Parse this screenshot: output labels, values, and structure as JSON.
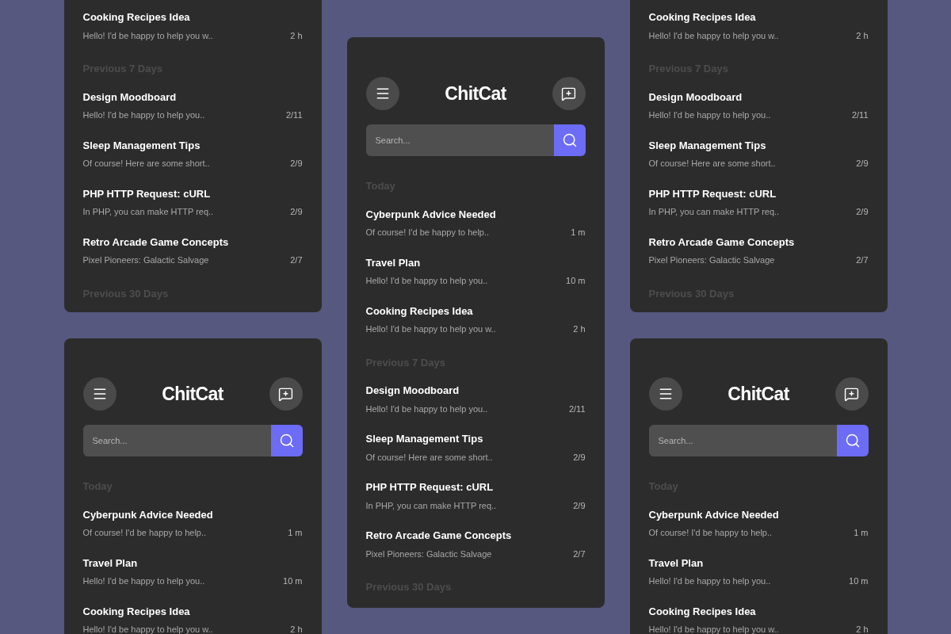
{
  "columns": [
    {
      "screens": [
        {
          "sections": [
            {
              "items": [
                {
                  "title": "Cooking Recipes Idea",
                  "preview": "Hello! I'd be happy to help you w..",
                  "time": "2 h"
                }
              ]
            },
            {
              "title": "Previous 7 Days",
              "items": [
                {
                  "title": "Design Moodboard",
                  "preview": "Hello! I'd be happy to help you..",
                  "time": "2/11"
                },
                {
                  "title": "Sleep Management Tips",
                  "preview": "Of course! Here are some short..",
                  "time": "2/9"
                },
                {
                  "title": "PHP HTTP Request: cURL",
                  "preview": "In PHP, you can make HTTP req..",
                  "time": "2/9"
                },
                {
                  "title": "Retro Arcade Game Concepts",
                  "preview": "Pixel Pioneers: Galactic Salvage",
                  "time": "2/7"
                }
              ]
            },
            {
              "title": "Previous 30 Days"
            }
          ]
        },
        {
          "header": {
            "logo": "ChitCat",
            "search_placeholder": "Search..."
          },
          "sections": [
            {
              "title": "Today",
              "items": [
                {
                  "title": "Cyberpunk Advice Needed",
                  "preview": "Of course! I'd be happy to help..",
                  "time": "1 m"
                },
                {
                  "title": "Travel Plan",
                  "preview": "Hello! I'd be happy to help you..",
                  "time": "10 m"
                },
                {
                  "title": "Cooking Recipes Idea",
                  "preview": "Hello! I'd be happy to help you w..",
                  "time": "2 h"
                }
              ]
            }
          ]
        }
      ]
    },
    {
      "screens": [
        {
          "header": {
            "logo": "ChitCat",
            "search_placeholder": "Search..."
          },
          "sections": [
            {
              "title": "Today",
              "items": [
                {
                  "title": "Cyberpunk Advice Needed",
                  "preview": "Of course! I'd be happy to help..",
                  "time": "1 m"
                },
                {
                  "title": "Travel Plan",
                  "preview": "Hello! I'd be happy to help you..",
                  "time": "10 m"
                },
                {
                  "title": "Cooking Recipes Idea",
                  "preview": "Hello! I'd be happy to help you w..",
                  "time": "2 h"
                }
              ]
            },
            {
              "title": "Previous 7 Days",
              "items": [
                {
                  "title": "Design Moodboard",
                  "preview": "Hello! I'd be happy to help you..",
                  "time": "2/11"
                },
                {
                  "title": "Sleep Management Tips",
                  "preview": "Of course! Here are some short..",
                  "time": "2/9"
                },
                {
                  "title": "PHP HTTP Request: cURL",
                  "preview": "In PHP, you can make HTTP req..",
                  "time": "2/9"
                },
                {
                  "title": "Retro Arcade Game Concepts",
                  "preview": "Pixel Pioneers: Galactic Salvage",
                  "time": "2/7"
                }
              ]
            },
            {
              "title": "Previous 30 Days"
            }
          ]
        }
      ]
    },
    {
      "screens": [
        {
          "sections": [
            {
              "items": [
                {
                  "title": "Cooking Recipes Idea",
                  "preview": "Hello! I'd be happy to help you w..",
                  "time": "2 h"
                }
              ]
            },
            {
              "title": "Previous 7 Days",
              "items": [
                {
                  "title": "Design Moodboard",
                  "preview": "Hello! I'd be happy to help you..",
                  "time": "2/11"
                },
                {
                  "title": "Sleep Management Tips",
                  "preview": "Of course! Here are some short..",
                  "time": "2/9"
                },
                {
                  "title": "PHP HTTP Request: cURL",
                  "preview": "In PHP, you can make HTTP req..",
                  "time": "2/9"
                },
                {
                  "title": "Retro Arcade Game Concepts",
                  "preview": "Pixel Pioneers: Galactic Salvage",
                  "time": "2/7"
                }
              ]
            },
            {
              "title": "Previous 30 Days"
            }
          ]
        },
        {
          "header": {
            "logo": "ChitCat",
            "search_placeholder": "Search..."
          },
          "sections": [
            {
              "title": "Today",
              "items": [
                {
                  "title": "Cyberpunk Advice Needed",
                  "preview": "Of course! I'd be happy to help..",
                  "time": "1 m"
                },
                {
                  "title": "Travel Plan",
                  "preview": "Hello! I'd be happy to help you..",
                  "time": "10 m"
                },
                {
                  "title": "Cooking Recipes Idea",
                  "preview": "Hello! I'd be happy to help you w..",
                  "time": "2 h"
                }
              ]
            }
          ]
        }
      ]
    }
  ]
}
